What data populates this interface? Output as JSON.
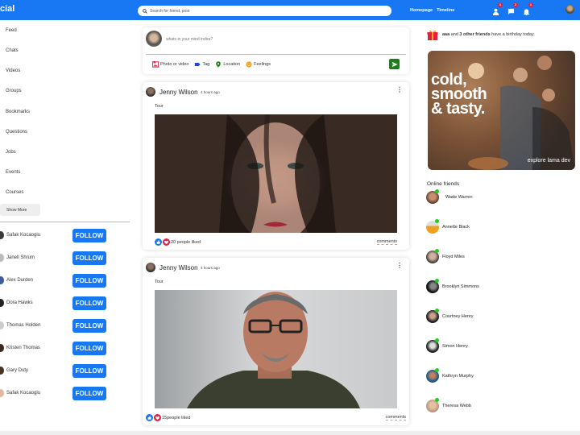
{
  "topbar": {
    "logo": "cial",
    "search_placeholder": "Search for friend, post",
    "links": [
      "Homepage",
      "Timeline"
    ],
    "badges": {
      "friends": "1",
      "messages": "2",
      "notifications": "1"
    },
    "colors": {
      "brand": "#1877f2",
      "badge": "#e41e3f"
    }
  },
  "sidebar": {
    "items": [
      {
        "label": "Feed",
        "icon": "rss-icon"
      },
      {
        "label": "Chats",
        "icon": "chat-icon"
      },
      {
        "label": "Videos",
        "icon": "video-icon"
      },
      {
        "label": "Groups",
        "icon": "group-icon"
      },
      {
        "label": "Bookmarks",
        "icon": "bookmark-icon"
      },
      {
        "label": "Questions",
        "icon": "help-icon"
      },
      {
        "label": "Jobs",
        "icon": "work-icon"
      },
      {
        "label": "Events",
        "icon": "event-icon"
      },
      {
        "label": "Courses",
        "icon": "school-icon"
      }
    ],
    "show_more": "Show More",
    "follow_label": "FOLLOW",
    "suggestions": [
      "Safak Kocaoglu",
      "Janell Shrum",
      "Alex Durden",
      "Dora Hawks",
      "Thomas Holden",
      "Kristen Thomas",
      "Gary Duty",
      "Safak Kocaoglu"
    ]
  },
  "share": {
    "placeholder": "whats in your mind indira?",
    "options": [
      "Photo or video",
      "Tag",
      "Location",
      "Feelings"
    ]
  },
  "posts": [
    {
      "author": "Jenny Wilson",
      "time": "4 hours ago",
      "text": "Tour",
      "likes": "20 people liked",
      "comments": "comments"
    },
    {
      "author": "Jenny Wilson",
      "time": "4 hours ago",
      "text": "Tour",
      "likes": "15people liked",
      "comments": "comments"
    }
  ],
  "rightbar": {
    "birthday": {
      "name": "aaa",
      "mid": " and ",
      "others": "3 other friends",
      "rest": " have a birthday today."
    },
    "ad": {
      "headline": [
        "cold,",
        "smooth",
        "& tasty."
      ],
      "tag": "explore lama dev"
    },
    "online_title": "Online friends",
    "online_friends": [
      "Wade Warren",
      "Annette Black",
      "Floyd Miles",
      "Brooklyn Simmons",
      "Courtney Henry",
      "Simon Henry",
      "Kathryn Murphy",
      "Theresa Webb"
    ]
  }
}
